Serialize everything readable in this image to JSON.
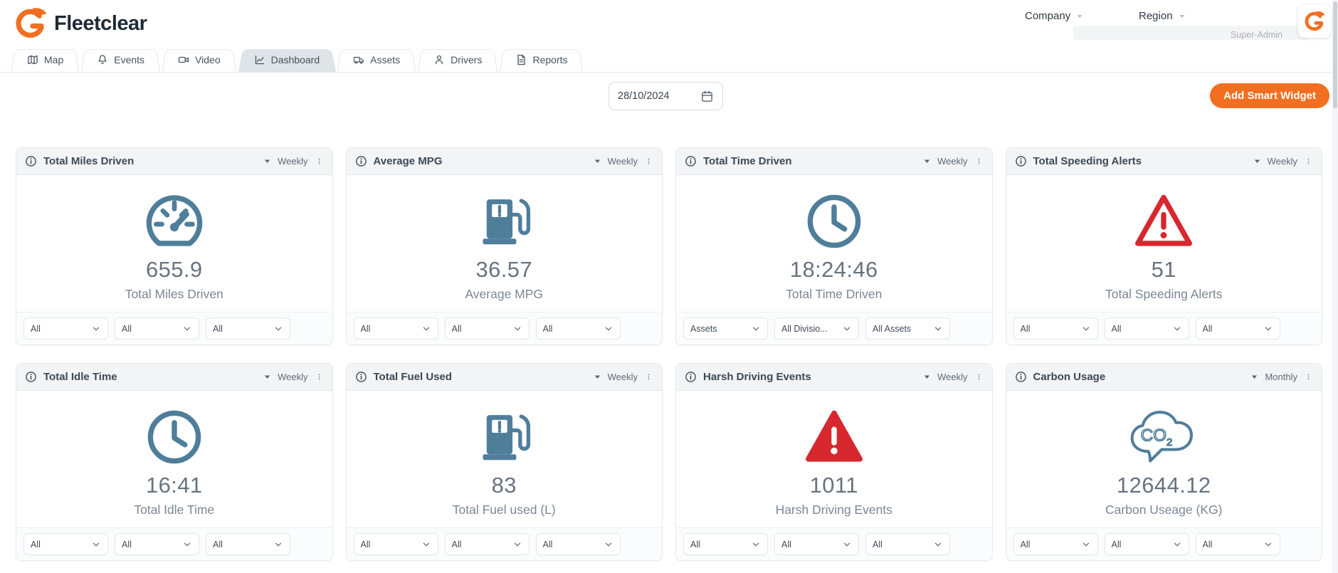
{
  "brand": {
    "name": "Fleetclear"
  },
  "header": {
    "company_label": "Company",
    "region_label": "Region",
    "role_label": "Super-Admin"
  },
  "tabs": [
    {
      "label": "Map",
      "icon": "map",
      "active": false
    },
    {
      "label": "Events",
      "icon": "bell",
      "active": false
    },
    {
      "label": "Video",
      "icon": "video-camera",
      "active": false
    },
    {
      "label": "Dashboard",
      "icon": "line-chart",
      "active": true
    },
    {
      "label": "Assets",
      "icon": "truck",
      "active": false
    },
    {
      "label": "Drivers",
      "icon": "person",
      "active": false
    },
    {
      "label": "Reports",
      "icon": "document",
      "active": false
    }
  ],
  "toolbar": {
    "date_value": "28/10/2024",
    "add_widget_label": "Add Smart Widget"
  },
  "colors": {
    "brand_orange": "#F26F21",
    "icon_blue": "#4F7E9B",
    "alert_red": "#D7282F"
  },
  "widgets": [
    {
      "title": "Total Miles Driven",
      "period": "Weekly",
      "icon": "speedometer-icon",
      "color": "blue",
      "value": "655.9",
      "label": "Total Miles Driven",
      "filters": [
        "All",
        "All",
        "All"
      ]
    },
    {
      "title": "Average MPG",
      "period": "Weekly",
      "icon": "fuel-pump-icon",
      "color": "blue",
      "value": "36.57",
      "label": "Average MPG",
      "filters": [
        "All",
        "All",
        "All"
      ]
    },
    {
      "title": "Total Time Driven",
      "period": "Weekly",
      "icon": "clock-icon",
      "color": "blue",
      "value": "18:24:46",
      "label": "Total Time Driven",
      "filters": [
        "Assets",
        "All Divisio...",
        "All Assets"
      ]
    },
    {
      "title": "Total Speeding Alerts",
      "period": "Weekly",
      "icon": "warning-outline-icon",
      "color": "red",
      "value": "51",
      "label": "Total Speeding Alerts",
      "filters": [
        "All",
        "All",
        "All"
      ]
    },
    {
      "title": "Total Idle Time",
      "period": "Weekly",
      "icon": "clock-icon",
      "color": "blue",
      "value": "16:41",
      "label": "Total Idle Time",
      "filters": [
        "All",
        "All",
        "All"
      ]
    },
    {
      "title": "Total Fuel Used",
      "period": "Weekly",
      "icon": "fuel-pump-icon",
      "color": "blue",
      "value": "83",
      "label": "Total Fuel used (L)",
      "filters": [
        "All",
        "All",
        "All"
      ]
    },
    {
      "title": "Harsh Driving Events",
      "period": "Weekly",
      "icon": "warning-filled-icon",
      "color": "red",
      "value": "1011",
      "label": "Harsh Driving Events",
      "filters": [
        "All",
        "All",
        "All"
      ]
    },
    {
      "title": "Carbon Usage",
      "period": "Monthly",
      "icon": "co2-cloud-icon",
      "color": "blue",
      "value": "12644.12",
      "label": "Carbon Useage (KG)",
      "filters": [
        "All",
        "All",
        "All"
      ]
    }
  ]
}
